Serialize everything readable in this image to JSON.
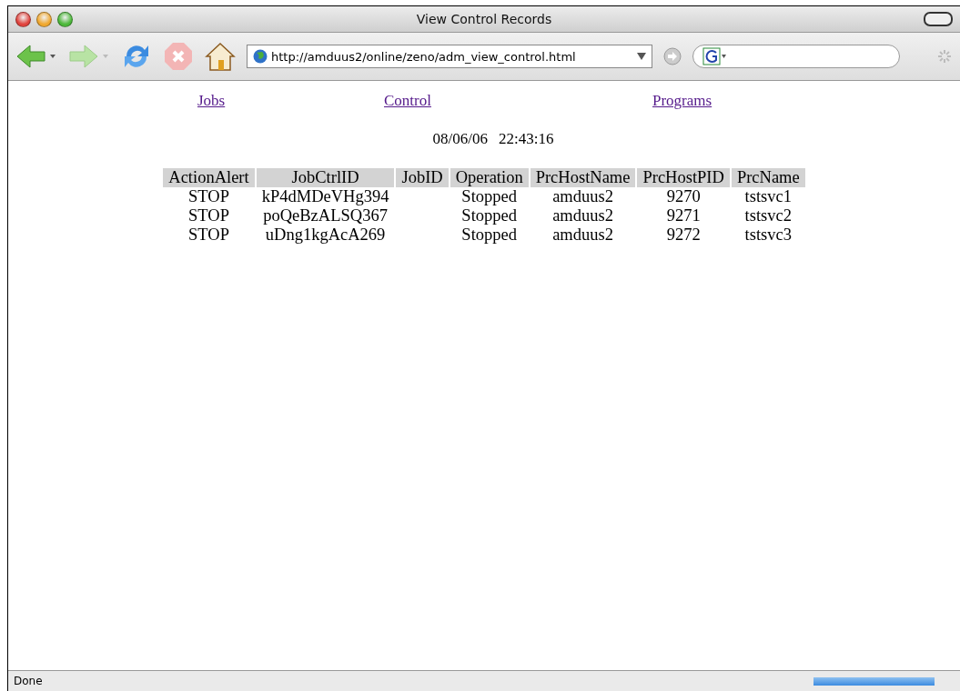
{
  "window": {
    "title": "View Control Records"
  },
  "address_bar": {
    "value": "http://amduus2/online/zeno/adm_view_control.html"
  },
  "nav_links": [
    {
      "label": "Jobs"
    },
    {
      "label": "Control"
    },
    {
      "label": "Programs"
    }
  ],
  "timestamp": {
    "date": "08/06/06",
    "time": "22:43:16"
  },
  "table": {
    "columns": [
      "ActionAlert",
      "JobCtrlID",
      "JobID",
      "Operation",
      "PrcHostName",
      "PrcHostPID",
      "PrcName"
    ],
    "rows": [
      [
        "STOP",
        "kP4dMDeVHg394",
        "",
        "Stopped",
        "amduus2",
        "9270",
        "tstsvc1"
      ],
      [
        "STOP",
        "poQeBzALSQ367",
        "",
        "Stopped",
        "amduus2",
        "9271",
        "tstsvc2"
      ],
      [
        "STOP",
        "uDng1kgAcA269",
        "",
        "Stopped",
        "amduus2",
        "9272",
        "tstsvc3"
      ]
    ]
  },
  "status_bar": {
    "text": "Done",
    "progress": {
      "level": 1
    }
  }
}
